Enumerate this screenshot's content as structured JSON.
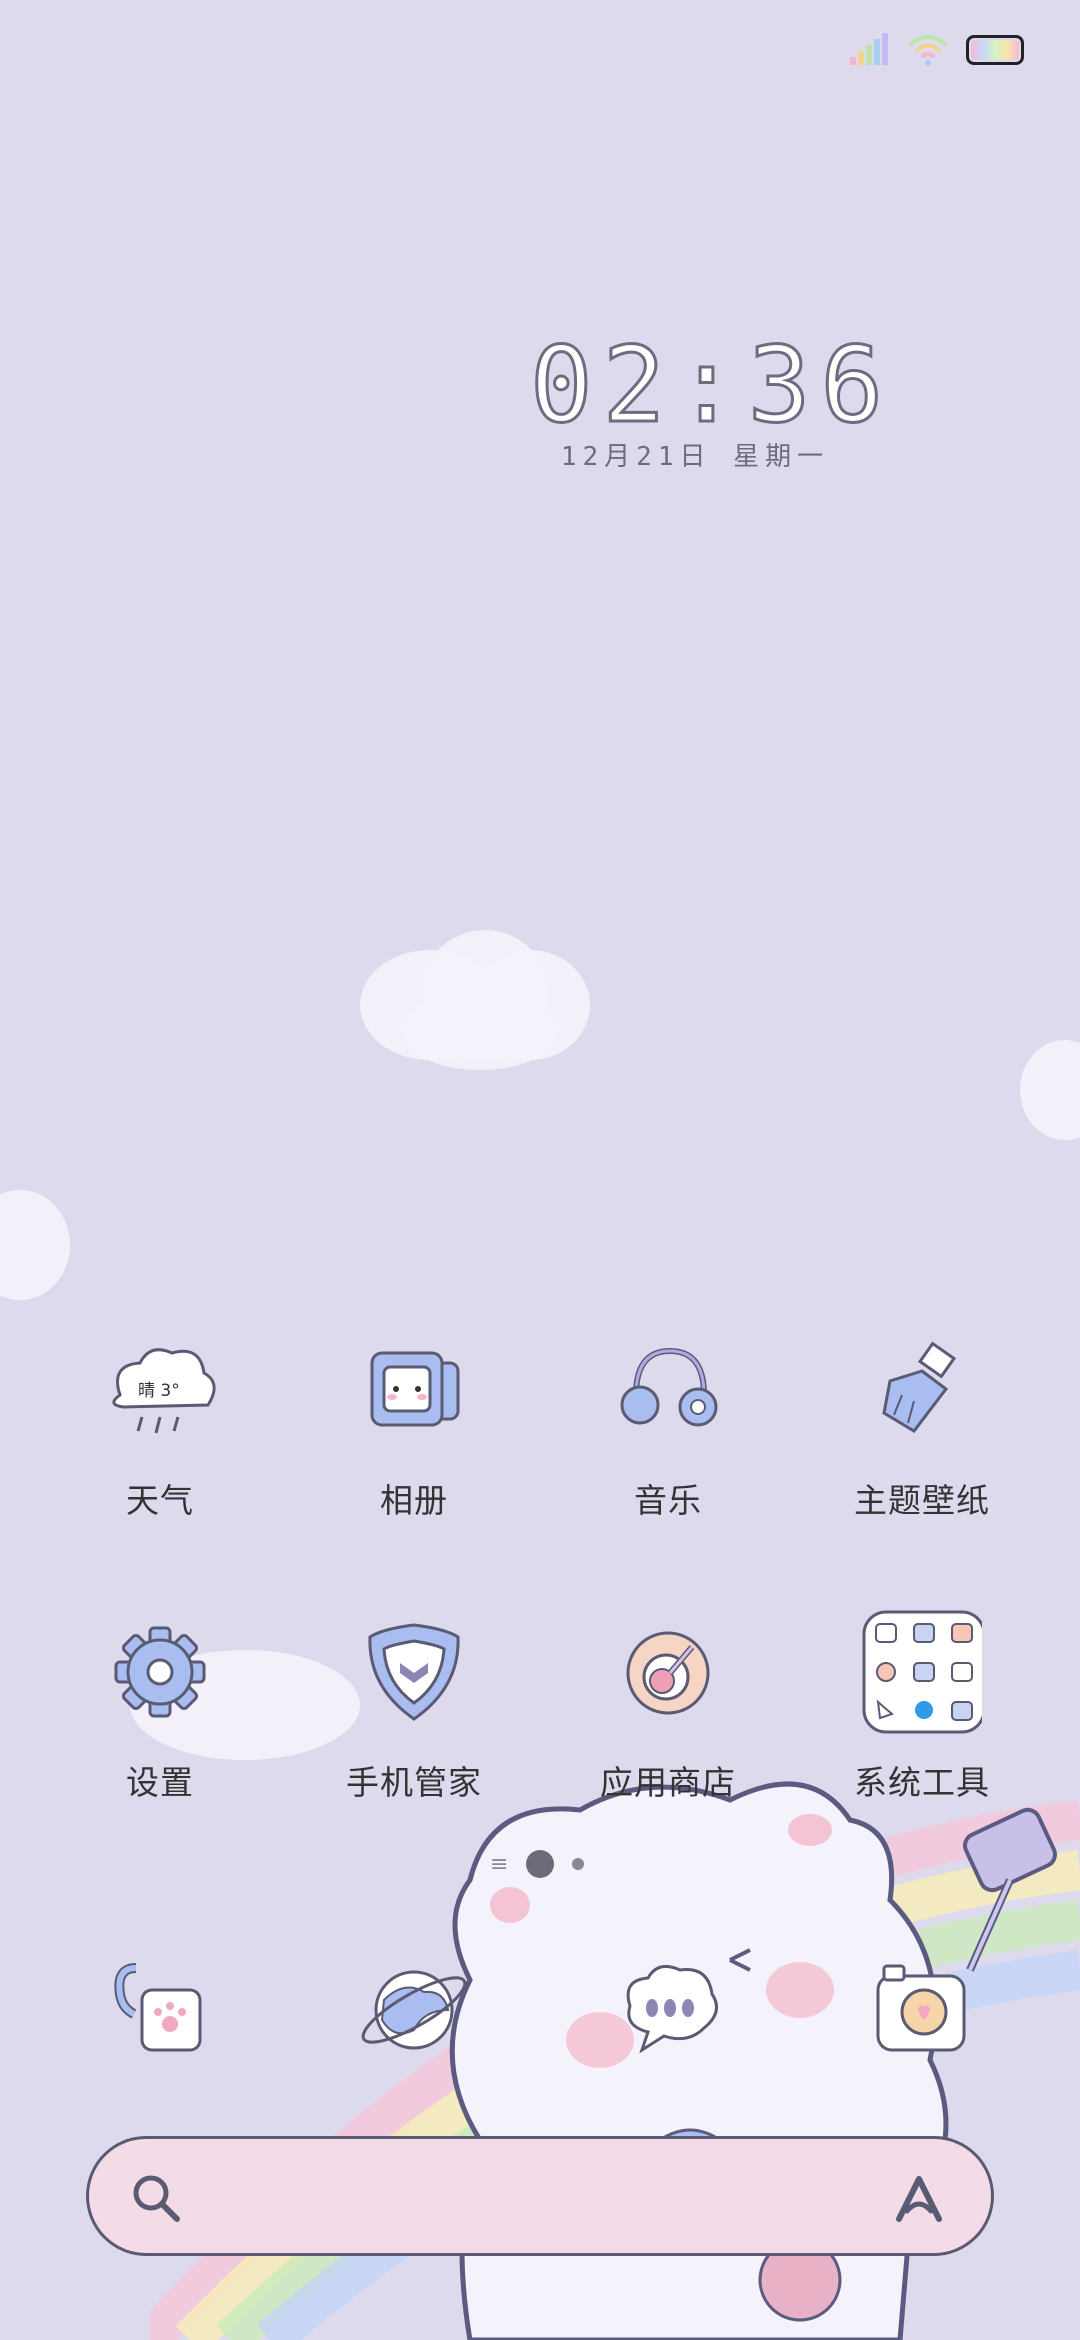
{
  "clock": {
    "time": "02:36",
    "date": "12月21日  星期一"
  },
  "weather_widget": {
    "text": "晴 3°"
  },
  "apps": [
    {
      "label": "天气",
      "icon": "weather-icon"
    },
    {
      "label": "相册",
      "icon": "gallery-icon"
    },
    {
      "label": "音乐",
      "icon": "music-icon"
    },
    {
      "label": "主题壁纸",
      "icon": "theme-wallpaper-icon"
    },
    {
      "label": "设置",
      "icon": "settings-gear-icon"
    },
    {
      "label": "手机管家",
      "icon": "phone-manager-shield-icon"
    },
    {
      "label": "应用商店",
      "icon": "app-store-icon"
    },
    {
      "label": "系统工具",
      "icon": "system-tools-folder-icon"
    }
  ],
  "dock": [
    {
      "icon": "phone-icon"
    },
    {
      "icon": "browser-icon"
    },
    {
      "icon": "messages-icon"
    },
    {
      "icon": "camera-icon"
    }
  ],
  "pager": {
    "pages": 2,
    "active": 1,
    "menu_glyph": "≡"
  },
  "colors": {
    "background": "#dedaee",
    "search_bg": "#f3dbe7",
    "outline": "#5b5a73",
    "accent_blue": "#9db3ee"
  }
}
